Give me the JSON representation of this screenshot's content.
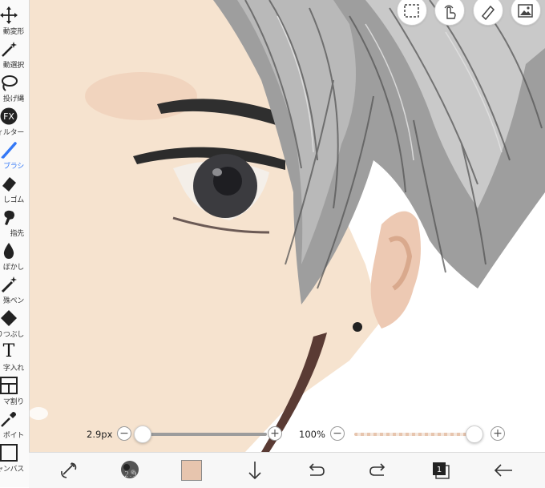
{
  "tools": [
    {
      "label": "動変形",
      "icon": "move-icon"
    },
    {
      "label": "動選択",
      "icon": "magic-wand-icon"
    },
    {
      "label": "投げ縄",
      "icon": "lasso-icon"
    },
    {
      "label": "ィルター",
      "icon": "fx-icon",
      "fx": "FX"
    },
    {
      "label": "ブラシ",
      "icon": "brush-icon",
      "active": true
    },
    {
      "label": "しゴム",
      "icon": "eraser-icon"
    },
    {
      "label": "指先",
      "icon": "finger-icon"
    },
    {
      "label": "ぼかし",
      "icon": "blur-drop-icon"
    },
    {
      "label": "殊ペン",
      "icon": "special-pen-icon"
    },
    {
      "label": "りつぶし",
      "icon": "fill-icon"
    },
    {
      "label": "字入れ",
      "icon": "text-icon",
      "glyph": "T"
    },
    {
      "label": "マ割り",
      "icon": "frame-divide-icon"
    },
    {
      "label": "ポイト",
      "icon": "eyedropper-icon"
    },
    {
      "label": "ャンバス",
      "icon": "canvas-icon"
    }
  ],
  "top_buttons": [
    "selection-icon",
    "gesture-icon",
    "ruler-icon",
    "layer-image-icon"
  ],
  "brush_size": {
    "label": "2.9px",
    "minus": "−",
    "plus": "+",
    "level": 0.0
  },
  "opacity": {
    "label": "100%",
    "minus": "−",
    "plus": "+",
    "level": 1.0
  },
  "brush_preview_value": "2.9",
  "current_color": "#e7c5ae",
  "accent_color": "#3478f6",
  "layer_count": "1",
  "bottom_icons": [
    "transform-icon",
    "brush-preview-icon",
    "color-swatch",
    "download-arrow-icon",
    "undo-icon",
    "redo-icon",
    "layers-icon",
    "back-arrow-icon"
  ]
}
